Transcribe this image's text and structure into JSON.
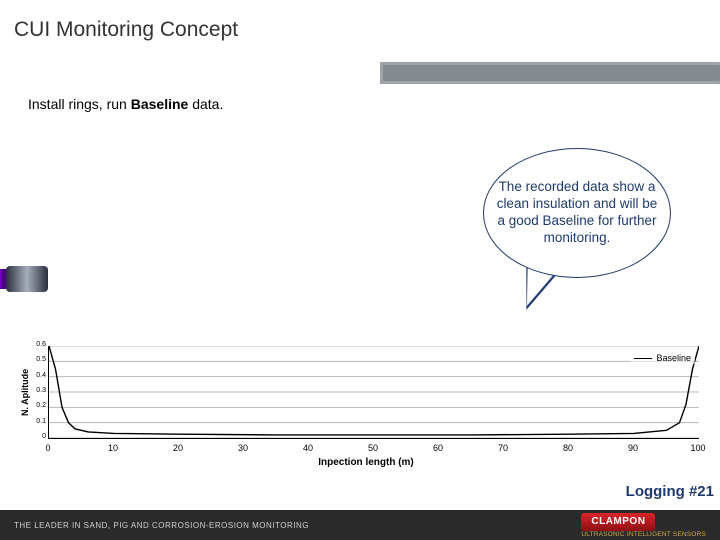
{
  "title": "CUI Monitoring Concept",
  "instruction_prefix": "Install rings, run ",
  "instruction_bold": "Baseline",
  "instruction_suffix": " data.",
  "callout_text": "The recorded data show a clean insulation and will be a good Baseline for further monitoring.",
  "logging_label": "Logging #21",
  "footer_left": "THE LEADER IN SAND, PIG AND CORROSION-EROSION MONITORING",
  "brand_name": "CLAMPON",
  "brand_sub": "ULTRASONIC INTELLIGENT SENSORS",
  "chart_data": {
    "type": "line",
    "title": "",
    "xlabel": "Inpection length (m)",
    "ylabel": "N. Aplitude",
    "xlim": [
      0,
      100
    ],
    "ylim": [
      0,
      0.6
    ],
    "xticks": [
      0,
      10,
      20,
      30,
      40,
      50,
      60,
      70,
      80,
      90,
      100
    ],
    "yticks": [
      0,
      0.1,
      0.2,
      0.3,
      0.4,
      0.5,
      0.6
    ],
    "series": [
      {
        "name": "Baseline",
        "x": [
          0,
          1,
          2,
          3,
          4,
          6,
          10,
          20,
          35,
          50,
          65,
          80,
          90,
          95,
          97,
          98,
          99,
          100
        ],
        "values": [
          0.6,
          0.45,
          0.2,
          0.1,
          0.06,
          0.04,
          0.03,
          0.025,
          0.02,
          0.02,
          0.02,
          0.025,
          0.03,
          0.05,
          0.1,
          0.22,
          0.45,
          0.6
        ]
      }
    ]
  }
}
